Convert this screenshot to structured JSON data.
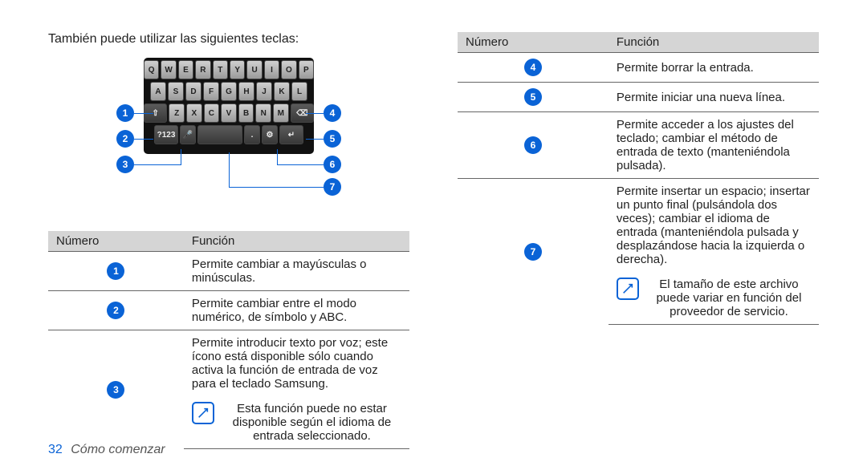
{
  "intro": "También puede utilizar las siguientes teclas:",
  "keyboard": {
    "row1": [
      "Q",
      "W",
      "E",
      "R",
      "T",
      "Y",
      "U",
      "I",
      "O",
      "P"
    ],
    "row2": [
      "A",
      "S",
      "D",
      "F",
      "G",
      "H",
      "J",
      "K",
      "L"
    ],
    "row3_shift": "⇧",
    "row3": [
      "Z",
      "X",
      "C",
      "V",
      "B",
      "N",
      "M"
    ],
    "row3_del": "⌫",
    "row4_mode": "?123",
    "row4_mic": "🎤",
    "row4_dot": ".",
    "row4_gear": "⚙",
    "row4_enter": "↵"
  },
  "marker_labels": {
    "m1": "1",
    "m2": "2",
    "m3": "3",
    "m4": "4",
    "m5": "5",
    "m6": "6",
    "m7": "7"
  },
  "left_table": {
    "head_num": "Número",
    "head_func": "Función",
    "rows": [
      {
        "num": "1",
        "text": "Permite cambiar a mayúsculas o minúsculas."
      },
      {
        "num": "2",
        "text": "Permite cambiar entre el modo numérico, de símbolo y ABC."
      },
      {
        "num": "3",
        "text": "Permite introducir texto por voz; este ícono está disponible sólo cuando activa la función de entrada de voz para el teclado Samsung.",
        "note": "Esta función puede no estar disponible según el idioma de entrada seleccionado."
      }
    ]
  },
  "right_table": {
    "head_num": "Número",
    "head_func": "Función",
    "rows": [
      {
        "num": "4",
        "text": "Permite borrar la entrada."
      },
      {
        "num": "5",
        "text": "Permite iniciar una nueva línea."
      },
      {
        "num": "6",
        "text": "Permite acceder a los ajustes del teclado; cambiar el método de entrada de texto (manteniéndola pulsada)."
      },
      {
        "num": "7",
        "text": "Permite insertar un espacio; insertar un punto final (pulsándola dos veces); cambiar el idioma de entrada (manteniéndola pulsada y desplazándose hacia la izquierda o derecha).",
        "note": "El tamaño de este archivo puede variar en función del proveedor de servicio."
      }
    ]
  },
  "footer": {
    "page": "32",
    "chapter": "Cómo comenzar"
  }
}
